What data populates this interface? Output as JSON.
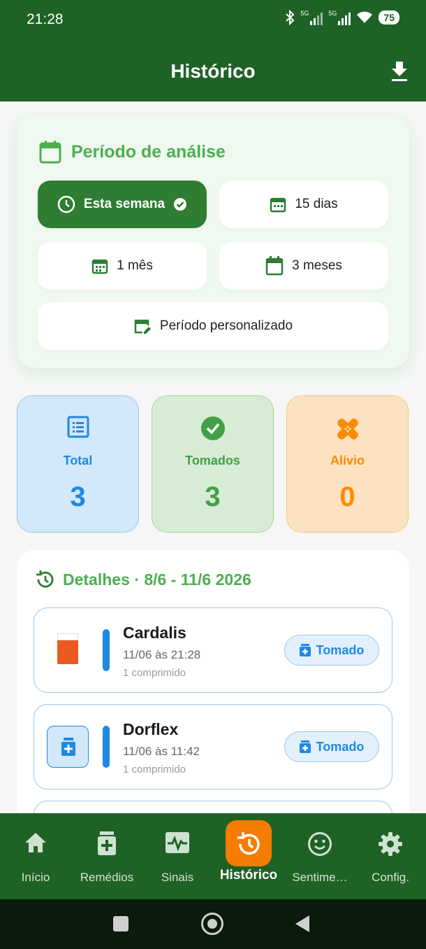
{
  "status_bar": {
    "time": "21:28",
    "network_1": "5G",
    "network_2": "5G",
    "battery": "75"
  },
  "header": {
    "title": "Histórico"
  },
  "period": {
    "title": "Período de análise",
    "options": [
      {
        "label": "Esta semana",
        "selected": true
      },
      {
        "label": "15 dias"
      },
      {
        "label": "1 mês"
      },
      {
        "label": "3 meses"
      },
      {
        "label": "Período personalizado"
      }
    ]
  },
  "stats": [
    {
      "label": "Total",
      "value": "3",
      "color": "#1e88e5"
    },
    {
      "label": "Tomados",
      "value": "3",
      "color": "#43a047"
    },
    {
      "label": "Alívio",
      "value": "0",
      "color": "#fb8c00"
    }
  ],
  "details": {
    "title": "Detalhes · 8/6 - 11/6 2026",
    "items": [
      {
        "name": "Cardalis",
        "when": "11/06 às 21:28",
        "dose": "1 comprimido",
        "status": "Tomado"
      },
      {
        "name": "Dorflex",
        "when": "11/06 às 11:42",
        "dose": "1 comprimido",
        "status": "Tomado"
      }
    ]
  },
  "bottom_nav": [
    {
      "label": "Início",
      "icon": "home-icon"
    },
    {
      "label": "Remédios",
      "icon": "medicine-icon"
    },
    {
      "label": "Sinais",
      "icon": "vitals-icon"
    },
    {
      "label": "Histórico",
      "icon": "history-icon",
      "active": true
    },
    {
      "label": "Sentime…",
      "icon": "smile-icon"
    },
    {
      "label": "Config.",
      "icon": "gear-icon"
    }
  ],
  "colors": {
    "primary": "#1f6226",
    "accent": "#f57c00",
    "green": "#4caf50",
    "blue": "#1e88e5",
    "orange": "#fb8c00"
  }
}
